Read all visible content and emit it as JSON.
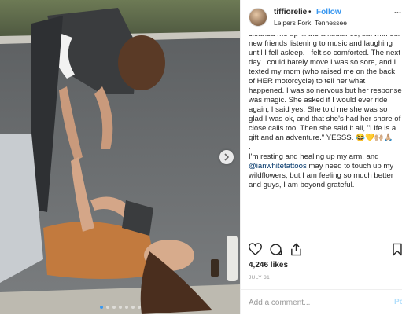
{
  "header": {
    "username": "tiffiorelie",
    "bullet": "•",
    "follow_label": "Follow",
    "location": "Leipers Fork, Tennessee",
    "more": "..."
  },
  "caption": {
    "text_before_mention": "cleaned me up in the ambulance, sat with our new friends listening to music and laughing until I fell asleep. I felt so comforted. The next day I could barely move I was so sore, and I texted my mom (who raised me on the back of HER motorcycle) to tell her what happened. I was so nervous but her response was magic. She asked if I would ever ride again, I said yes. She told me she was so glad I was ok, and that she's had her share of close calls too. Then she said it all, \"Life is a gift and an adventure.\" YESSS. 😂💛🙌🏼🙏🏼\n.\nI'm resting and healing up my arm, and ",
    "mention": "@ianwhitetattoos",
    "text_after_mention": " may need to touch up my wildflowers, but I am feeling so much better and guys, I am beyond grateful."
  },
  "actions": {
    "like_icon": "heart-icon",
    "comment_icon": "comment-icon",
    "share_icon": "share-icon",
    "save_icon": "bookmark-icon"
  },
  "likes": "4,246 likes",
  "date": "JULY 31",
  "comment": {
    "placeholder": "Add a comment...",
    "post_label": "Post"
  },
  "carousel": {
    "next_icon": "chevron-right-icon",
    "slide_count": 7,
    "active_index": 0
  },
  "colors": {
    "link_blue": "#3897f0",
    "mention_blue": "#003569",
    "post_disabled": "#b2dffc"
  }
}
